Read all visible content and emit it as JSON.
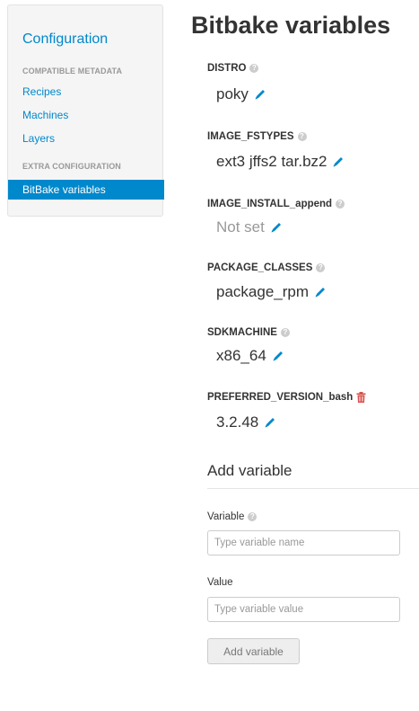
{
  "sidebar": {
    "title": "Configuration",
    "sections": [
      {
        "heading": "COMPATIBLE METADATA",
        "items": [
          {
            "label": "Recipes"
          },
          {
            "label": "Machines"
          },
          {
            "label": "Layers"
          }
        ]
      },
      {
        "heading": "EXTRA CONFIGURATION",
        "items": [
          {
            "label": "BitBake variables",
            "active": true
          }
        ]
      }
    ]
  },
  "main": {
    "title": "Bitbake variables",
    "variables": [
      {
        "name": "DISTRO",
        "value": "poky",
        "icon": "help-icon"
      },
      {
        "name": "IMAGE_FSTYPES",
        "value": "ext3 jffs2 tar.bz2",
        "icon": "help-icon"
      },
      {
        "name": "IMAGE_INSTALL_append",
        "value": "Not set",
        "icon": "help-icon",
        "not_set": true
      },
      {
        "name": "PACKAGE_CLASSES",
        "value": "package_rpm",
        "icon": "help-icon"
      },
      {
        "name": "SDKMACHINE",
        "value": "x86_64",
        "icon": "help-icon"
      },
      {
        "name": "PREFERRED_VERSION_bash",
        "value": "3.2.48",
        "icon": "trash-icon"
      }
    ],
    "add_variable": {
      "heading": "Add variable",
      "variable_label": "Variable",
      "variable_placeholder": "Type variable name",
      "value_label": "Value",
      "value_placeholder": "Type variable value",
      "button_label": "Add variable"
    }
  },
  "colors": {
    "link": "#0088cc",
    "active_bg": "#0088cc",
    "trash": "#d9534f"
  }
}
